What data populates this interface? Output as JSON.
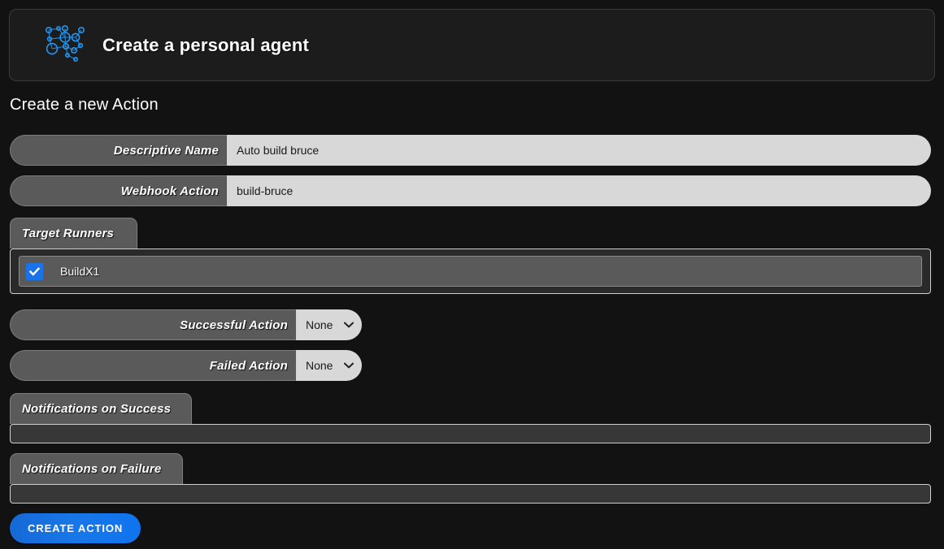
{
  "header": {
    "logo_icon": "network-nodes-icon",
    "title": "Create a personal agent"
  },
  "section": {
    "title": "Create a new Action"
  },
  "form": {
    "descriptive_name": {
      "label": "Descriptive Name",
      "value": "Auto build bruce",
      "placeholder": ""
    },
    "webhook_action": {
      "label": "Webhook Action",
      "value": "build-bruce",
      "placeholder": ""
    },
    "target_runners": {
      "label": "Target Runners",
      "runners": [
        {
          "name": "BuildX1",
          "checked": true
        }
      ]
    },
    "successful_action": {
      "label": "Successful Action",
      "value": "None",
      "options": [
        "None"
      ]
    },
    "failed_action": {
      "label": "Failed Action",
      "value": "None",
      "options": [
        "None"
      ]
    },
    "notifications_on_success": {
      "label": "Notifications on Success",
      "value": ""
    },
    "notifications_on_failure": {
      "label": "Notifications on Failure",
      "value": ""
    },
    "submit": {
      "label": "CREATE ACTION"
    }
  },
  "colors": {
    "page_background": "#121212",
    "label_background": "#5a5a5a",
    "input_background": "#d8d8d8",
    "accent_blue": "#1a73e8",
    "checkbox_blue": "#1a73e8",
    "panel_background": "#2a2a2a",
    "logo_blue": "#2196f3"
  }
}
